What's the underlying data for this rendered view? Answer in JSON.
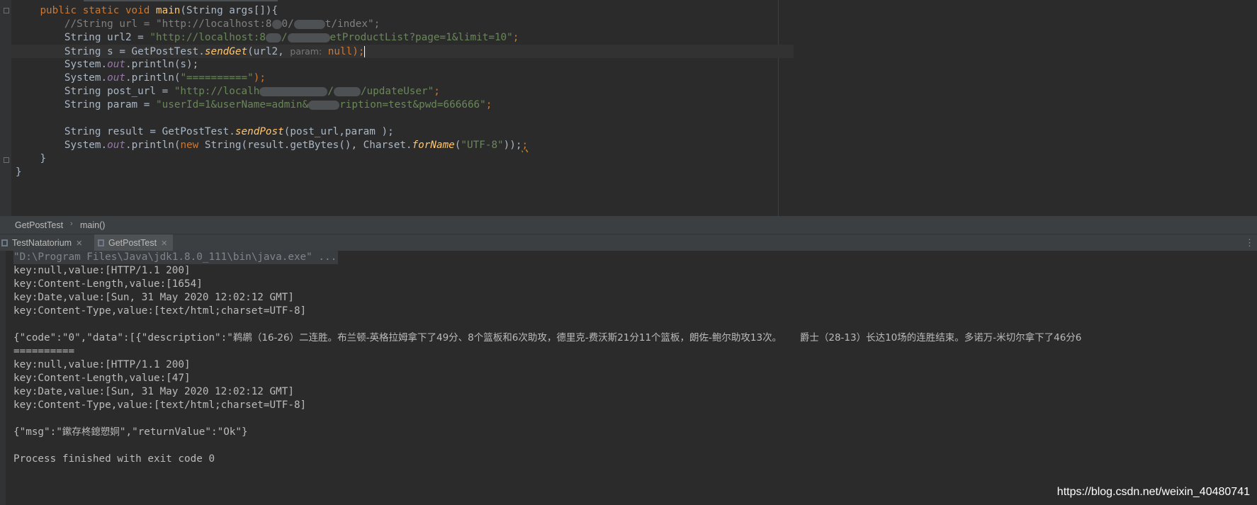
{
  "editor": {
    "lines": [
      {
        "indent": "    ",
        "kw1": "public static void ",
        "fn": "main",
        "rest": "(String args[]){"
      },
      {
        "indent": "        ",
        "cmt_a": "//String url = \"http://localhost:8",
        "cmt_b": "0/",
        "cmt_c": "t/index\";"
      },
      {
        "indent": "        ",
        "pre": "String url2 = ",
        "str_a": "\"http://localhost:8",
        "str_b": "/",
        "str_c": "etProductList?page=1&limit=10\"",
        "semi": ";"
      },
      {
        "indent": "        ",
        "pre": "String s = GetPostTest.",
        "method": "sendGet",
        "open": "(url2, ",
        "hint": "param:",
        "kw": " null",
        "close": ");"
      },
      {
        "indent": "        ",
        "pre": "System.",
        "field": "out",
        "post": ".println(s);"
      },
      {
        "indent": "        ",
        "pre": "System.",
        "field": "out",
        "post": ".println(",
        "str": "\"==========\"",
        "close": ");"
      },
      {
        "indent": "        ",
        "pre": "String post_url = ",
        "str_a": "\"http://localh",
        "str_b": "/",
        "str_c": "/updateUser\"",
        "semi": ";"
      },
      {
        "indent": "        ",
        "pre": "String param = ",
        "str_a": "\"userId=1&userName=admin&",
        "str_c": "ription=test&pwd=666666\"",
        "semi": ";"
      },
      {
        "indent": "",
        "blank": ""
      },
      {
        "indent": "        ",
        "pre": "String result = GetPostTest.",
        "method": "sendPost",
        "post": "(post_url,param );"
      },
      {
        "indent": "        ",
        "pre": "System.",
        "field": "out",
        "p2": ".println(",
        "kw": "new ",
        "p3": "String(result.getBytes(), Charset.",
        "method": "forName",
        "p4": "(",
        "str": "\"UTF-8\"",
        "p5": "));",
        "warn": ";"
      },
      {
        "indent": "    ",
        "brace": "}"
      },
      {
        "indent": "",
        "brace": "}"
      }
    ]
  },
  "breadcrumb": {
    "class": "GetPostTest",
    "method": "main()"
  },
  "run_tabs": [
    {
      "label": "TestNatatorium",
      "active": false
    },
    {
      "label": "GetPostTest",
      "active": true
    }
  ],
  "console": {
    "command": "\"D:\\Program Files\\Java\\jdk1.8.0_111\\bin\\java.exe\" ...",
    "block1": [
      "key:null,value:[HTTP/1.1 200]",
      "key:Content-Length,value:[1654]",
      "key:Date,value:[Sun, 31 May 2020 12:02:12 GMT]",
      "key:Content-Type,value:[text/html;charset=UTF-8]"
    ],
    "json_prefix": "{\"code\":\"0\",\"data\":[{\"description\":\"",
    "json_cjk": "鹈鹕（16-26）二连胜。布兰顿-英格拉姆拿下了49分、8个篮板和6次助攻，德里克-费沃斯21分11个篮板，朗佐-鲍尔助攻13次。      爵士（28-13）长达10场的连胜结束。多诺万-米切尔拿下了46分6",
    "separator": "==========",
    "block2": [
      "key:null,value:[HTTP/1.1 200]",
      "key:Content-Length,value:[47]",
      "key:Date,value:[Sun, 31 May 2020 12:02:12 GMT]",
      "key:Content-Type,value:[text/html;charset=UTF-8]"
    ],
    "msg_prefix": "{\"msg\":\"",
    "msg_cjk": "鏉存柊鎴愬姛",
    "msg_suffix": "\",\"returnValue\":\"Ok\"}",
    "exit": "Process finished with exit code 0"
  },
  "watermark": "https://blog.csdn.net/weixin_40480741",
  "colors": {
    "background": "#2b2b2b",
    "keyword": "#cc7832",
    "string": "#6a8759",
    "function": "#ffc66d",
    "field": "#9876aa",
    "comment": "#808080",
    "text": "#a9b7c6"
  }
}
